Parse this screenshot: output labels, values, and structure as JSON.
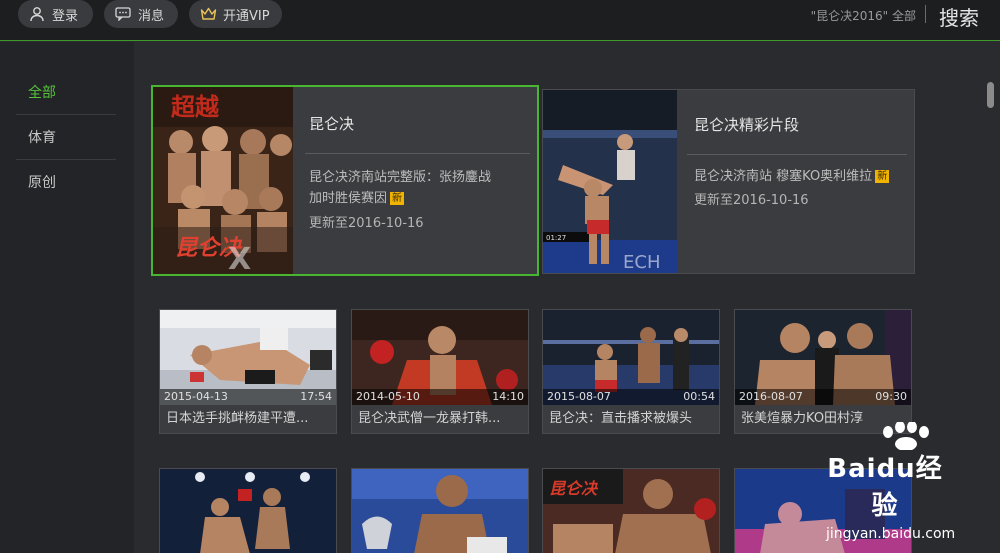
{
  "topbar": {
    "login": "登录",
    "messages": "消息",
    "vip": "开通VIP",
    "search_hint": "\"昆仑决2016\" 全部",
    "search": "搜索"
  },
  "sidebar": {
    "items": [
      {
        "label": "全部",
        "active": true
      },
      {
        "label": "体育",
        "active": false
      },
      {
        "label": "原创",
        "active": false
      }
    ]
  },
  "featured": [
    {
      "title": "昆仑决",
      "desc_line1": "昆仑决济南站完整版：张扬鏖战",
      "desc_line2": "加时胜侯赛因",
      "badge": "新",
      "updated": "更新至2016-10-16"
    },
    {
      "title": "昆仑决精彩片段",
      "desc": "昆仑决济南站 穆塞KO奥利维拉",
      "badge": "新",
      "updated": "更新至2016-10-16"
    }
  ],
  "videos": [
    {
      "date": "2015-04-13",
      "duration": "17:54",
      "title": "日本选手挑衅杨建平遭..."
    },
    {
      "date": "2014-05-10",
      "duration": "14:10",
      "title": "昆仑决武僧一龙暴打韩..."
    },
    {
      "date": "2015-08-07",
      "duration": "00:54",
      "title": "昆仑决：直击播求被爆头"
    },
    {
      "date": "2016-08-07",
      "duration": "09:30",
      "title": "张美煊暴力KO田村淳"
    }
  ],
  "watermark": {
    "brand": "Baidu经验",
    "url": "jingyan.baidu.com"
  },
  "colors": {
    "accent": "#49b632",
    "badge": "#f0b400",
    "background": "#2a2b2e"
  }
}
